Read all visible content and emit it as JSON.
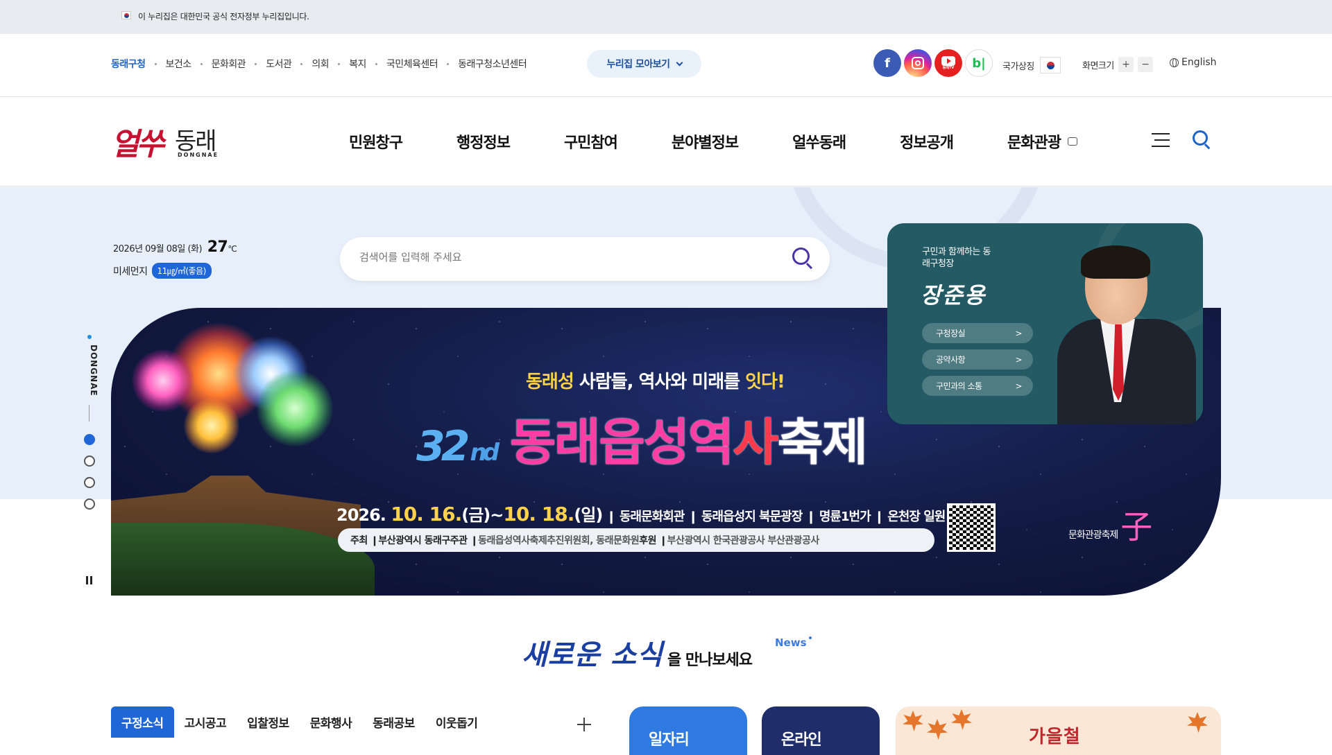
{
  "gov_bar": {
    "text": "이 누리집은 대한민국 공식 전자정부 누리집입니다."
  },
  "util": {
    "links": [
      "동래구청",
      "보건소",
      "문화회관",
      "도서관",
      "의회",
      "복지",
      "국민체육센터",
      "동래구청소년센터"
    ],
    "nuri_btn": "누리집 모아보기",
    "sns": [
      "facebook-icon",
      "instagram-icon",
      "youtube-icon",
      "blog-icon"
    ],
    "youtube_sub": "동래TV",
    "blog_letter": "b|",
    "national_symbol": "국가상징",
    "zoom_label": "화면크기",
    "zoom_in": "+",
    "zoom_out": "−",
    "lang": "English"
  },
  "logo": {
    "red": "얼쑤",
    "black": "동래",
    "en": "DONGNAE"
  },
  "gnb": {
    "menus": [
      "민원창구",
      "행정정보",
      "구민참여",
      "분야별정보",
      "얼쑤동래",
      "정보공개",
      "문화관광"
    ]
  },
  "hero": {
    "date": "2026년 09월 08일 (화)",
    "temp": "27",
    "temp_unit": "℃",
    "dust_label": "미세먼지",
    "dust_value": "11㎍/㎥(좋음)",
    "search_placeholder": "검색어를 입력해 주세요",
    "side_label": "DONGNAE"
  },
  "banner": {
    "sub_1": "동래성",
    "sub_2": " 사람들, 역사와 미래를 ",
    "sub_3": "잇다!",
    "edition": "32",
    "edition_suffix": "nd",
    "title_1": "동래읍성역",
    "title_2": "사",
    "title_3": "축제",
    "date_year": "2026.",
    "date_start": "10. 16.",
    "date_start_day": "(금)",
    "date_tilde": "~",
    "date_end": "10. 18.",
    "date_end_day": "(일)",
    "date_places": " ❙ 동래문화회관 ❙ 동래읍성지 북문광장 ❙ 명륜1번가 ❙ 온천장 일원",
    "host_label": "주최 ❙ ",
    "host": "부산광역시 동래구",
    "organizer_label": "  주관 ❙ ",
    "organizer": "동래읍성역사축제추진위원회, 동래문화원",
    "sponsor_label": "  후원 ❙ ",
    "sponsors": "부산광역시  한국관광공사  부산관광공사",
    "fest_logo_small": "문화관광축제",
    "fest_logo_big": "子"
  },
  "mayor": {
    "intro": "구민과 함께하는 동래구청장",
    "name": "장준용",
    "buttons": [
      "구청장실",
      "공약사항",
      "구민과의 소통"
    ]
  },
  "news": {
    "big": "새로운 소식",
    "small": "을 만나보세요",
    "tag": "News"
  },
  "tabs": [
    "구정소식",
    "고시공고",
    "입찰정보",
    "문화행사",
    "동래공보",
    "이웃돕기"
  ],
  "cards": {
    "job": "일자리",
    "online": "온라인",
    "autumn": "가을철"
  },
  "colors": {
    "primary": "#1f66d9",
    "navy": "#1f2e6b",
    "mayor_bg": "#235a63",
    "accent_red": "#c41230"
  }
}
